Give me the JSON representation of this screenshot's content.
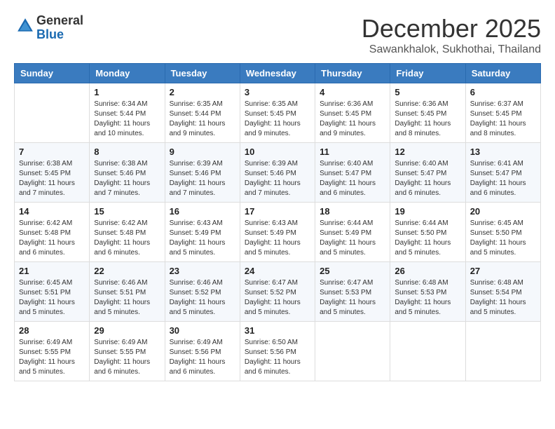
{
  "header": {
    "logo_general": "General",
    "logo_blue": "Blue",
    "month_title": "December 2025",
    "location": "Sawankhalok, Sukhothai, Thailand"
  },
  "days_of_week": [
    "Sunday",
    "Monday",
    "Tuesday",
    "Wednesday",
    "Thursday",
    "Friday",
    "Saturday"
  ],
  "weeks": [
    [
      {
        "day": "",
        "content": ""
      },
      {
        "day": "1",
        "content": "Sunrise: 6:34 AM\nSunset: 5:44 PM\nDaylight: 11 hours and 10 minutes."
      },
      {
        "day": "2",
        "content": "Sunrise: 6:35 AM\nSunset: 5:44 PM\nDaylight: 11 hours and 9 minutes."
      },
      {
        "day": "3",
        "content": "Sunrise: 6:35 AM\nSunset: 5:45 PM\nDaylight: 11 hours and 9 minutes."
      },
      {
        "day": "4",
        "content": "Sunrise: 6:36 AM\nSunset: 5:45 PM\nDaylight: 11 hours and 9 minutes."
      },
      {
        "day": "5",
        "content": "Sunrise: 6:36 AM\nSunset: 5:45 PM\nDaylight: 11 hours and 8 minutes."
      },
      {
        "day": "6",
        "content": "Sunrise: 6:37 AM\nSunset: 5:45 PM\nDaylight: 11 hours and 8 minutes."
      }
    ],
    [
      {
        "day": "7",
        "content": "Sunrise: 6:38 AM\nSunset: 5:45 PM\nDaylight: 11 hours and 7 minutes."
      },
      {
        "day": "8",
        "content": "Sunrise: 6:38 AM\nSunset: 5:46 PM\nDaylight: 11 hours and 7 minutes."
      },
      {
        "day": "9",
        "content": "Sunrise: 6:39 AM\nSunset: 5:46 PM\nDaylight: 11 hours and 7 minutes."
      },
      {
        "day": "10",
        "content": "Sunrise: 6:39 AM\nSunset: 5:46 PM\nDaylight: 11 hours and 7 minutes."
      },
      {
        "day": "11",
        "content": "Sunrise: 6:40 AM\nSunset: 5:47 PM\nDaylight: 11 hours and 6 minutes."
      },
      {
        "day": "12",
        "content": "Sunrise: 6:40 AM\nSunset: 5:47 PM\nDaylight: 11 hours and 6 minutes."
      },
      {
        "day": "13",
        "content": "Sunrise: 6:41 AM\nSunset: 5:47 PM\nDaylight: 11 hours and 6 minutes."
      }
    ],
    [
      {
        "day": "14",
        "content": "Sunrise: 6:42 AM\nSunset: 5:48 PM\nDaylight: 11 hours and 6 minutes."
      },
      {
        "day": "15",
        "content": "Sunrise: 6:42 AM\nSunset: 5:48 PM\nDaylight: 11 hours and 6 minutes."
      },
      {
        "day": "16",
        "content": "Sunrise: 6:43 AM\nSunset: 5:49 PM\nDaylight: 11 hours and 5 minutes."
      },
      {
        "day": "17",
        "content": "Sunrise: 6:43 AM\nSunset: 5:49 PM\nDaylight: 11 hours and 5 minutes."
      },
      {
        "day": "18",
        "content": "Sunrise: 6:44 AM\nSunset: 5:49 PM\nDaylight: 11 hours and 5 minutes."
      },
      {
        "day": "19",
        "content": "Sunrise: 6:44 AM\nSunset: 5:50 PM\nDaylight: 11 hours and 5 minutes."
      },
      {
        "day": "20",
        "content": "Sunrise: 6:45 AM\nSunset: 5:50 PM\nDaylight: 11 hours and 5 minutes."
      }
    ],
    [
      {
        "day": "21",
        "content": "Sunrise: 6:45 AM\nSunset: 5:51 PM\nDaylight: 11 hours and 5 minutes."
      },
      {
        "day": "22",
        "content": "Sunrise: 6:46 AM\nSunset: 5:51 PM\nDaylight: 11 hours and 5 minutes."
      },
      {
        "day": "23",
        "content": "Sunrise: 6:46 AM\nSunset: 5:52 PM\nDaylight: 11 hours and 5 minutes."
      },
      {
        "day": "24",
        "content": "Sunrise: 6:47 AM\nSunset: 5:52 PM\nDaylight: 11 hours and 5 minutes."
      },
      {
        "day": "25",
        "content": "Sunrise: 6:47 AM\nSunset: 5:53 PM\nDaylight: 11 hours and 5 minutes."
      },
      {
        "day": "26",
        "content": "Sunrise: 6:48 AM\nSunset: 5:53 PM\nDaylight: 11 hours and 5 minutes."
      },
      {
        "day": "27",
        "content": "Sunrise: 6:48 AM\nSunset: 5:54 PM\nDaylight: 11 hours and 5 minutes."
      }
    ],
    [
      {
        "day": "28",
        "content": "Sunrise: 6:49 AM\nSunset: 5:55 PM\nDaylight: 11 hours and 5 minutes."
      },
      {
        "day": "29",
        "content": "Sunrise: 6:49 AM\nSunset: 5:55 PM\nDaylight: 11 hours and 6 minutes."
      },
      {
        "day": "30",
        "content": "Sunrise: 6:49 AM\nSunset: 5:56 PM\nDaylight: 11 hours and 6 minutes."
      },
      {
        "day": "31",
        "content": "Sunrise: 6:50 AM\nSunset: 5:56 PM\nDaylight: 11 hours and 6 minutes."
      },
      {
        "day": "",
        "content": ""
      },
      {
        "day": "",
        "content": ""
      },
      {
        "day": "",
        "content": ""
      }
    ]
  ]
}
